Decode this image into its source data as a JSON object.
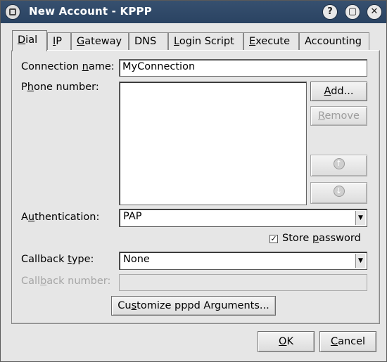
{
  "window": {
    "title": "New Account - KPPP",
    "title_buttons": {
      "help": "?",
      "maximize": "▢",
      "close": "✕"
    }
  },
  "tabs": [
    {
      "label": "Dial",
      "mn": "D",
      "rest": "ial"
    },
    {
      "label": "IP",
      "mn": "I",
      "rest": "P"
    },
    {
      "label": "Gateway",
      "mn": "G",
      "rest": "ateway"
    },
    {
      "label": "DNS",
      "mn": "",
      "rest": "DNS"
    },
    {
      "label": "Login Script",
      "mn": "L",
      "rest": "ogin Script"
    },
    {
      "label": "Execute",
      "mn": "E",
      "rest": "xecute"
    },
    {
      "label": "Accounting",
      "mn": "",
      "rest": "Accounting"
    }
  ],
  "form": {
    "connection_name": {
      "label_pre": "Connection ",
      "label_mn": "n",
      "label_post": "ame:",
      "value": "MyConnection"
    },
    "phone_number": {
      "label_pre": "P",
      "label_mn": "h",
      "label_post": "one number:"
    },
    "add_button": {
      "pre": "",
      "mn": "A",
      "post": "dd..."
    },
    "remove_button": {
      "pre": "",
      "mn": "R",
      "post": "emove"
    },
    "authentication": {
      "label_pre": "A",
      "label_mn": "u",
      "label_post": "thentication:",
      "value": "PAP"
    },
    "store_password": {
      "pre": "Store ",
      "mn": "p",
      "post": "assword",
      "checked": "✓"
    },
    "callback_type": {
      "label_pre": "Callback ",
      "label_mn": "t",
      "label_post": "ype:",
      "value": "None"
    },
    "callback_number": {
      "label_pre": "Call",
      "label_mn": "b",
      "label_post": "ack number:"
    },
    "customize_button": {
      "pre": "Cu",
      "mn": "s",
      "post": "tomize pppd Arguments..."
    }
  },
  "buttons": {
    "ok": {
      "pre": "",
      "mn": "O",
      "post": "K"
    },
    "cancel": {
      "pre": "",
      "mn": "C",
      "post": "ancel"
    }
  }
}
